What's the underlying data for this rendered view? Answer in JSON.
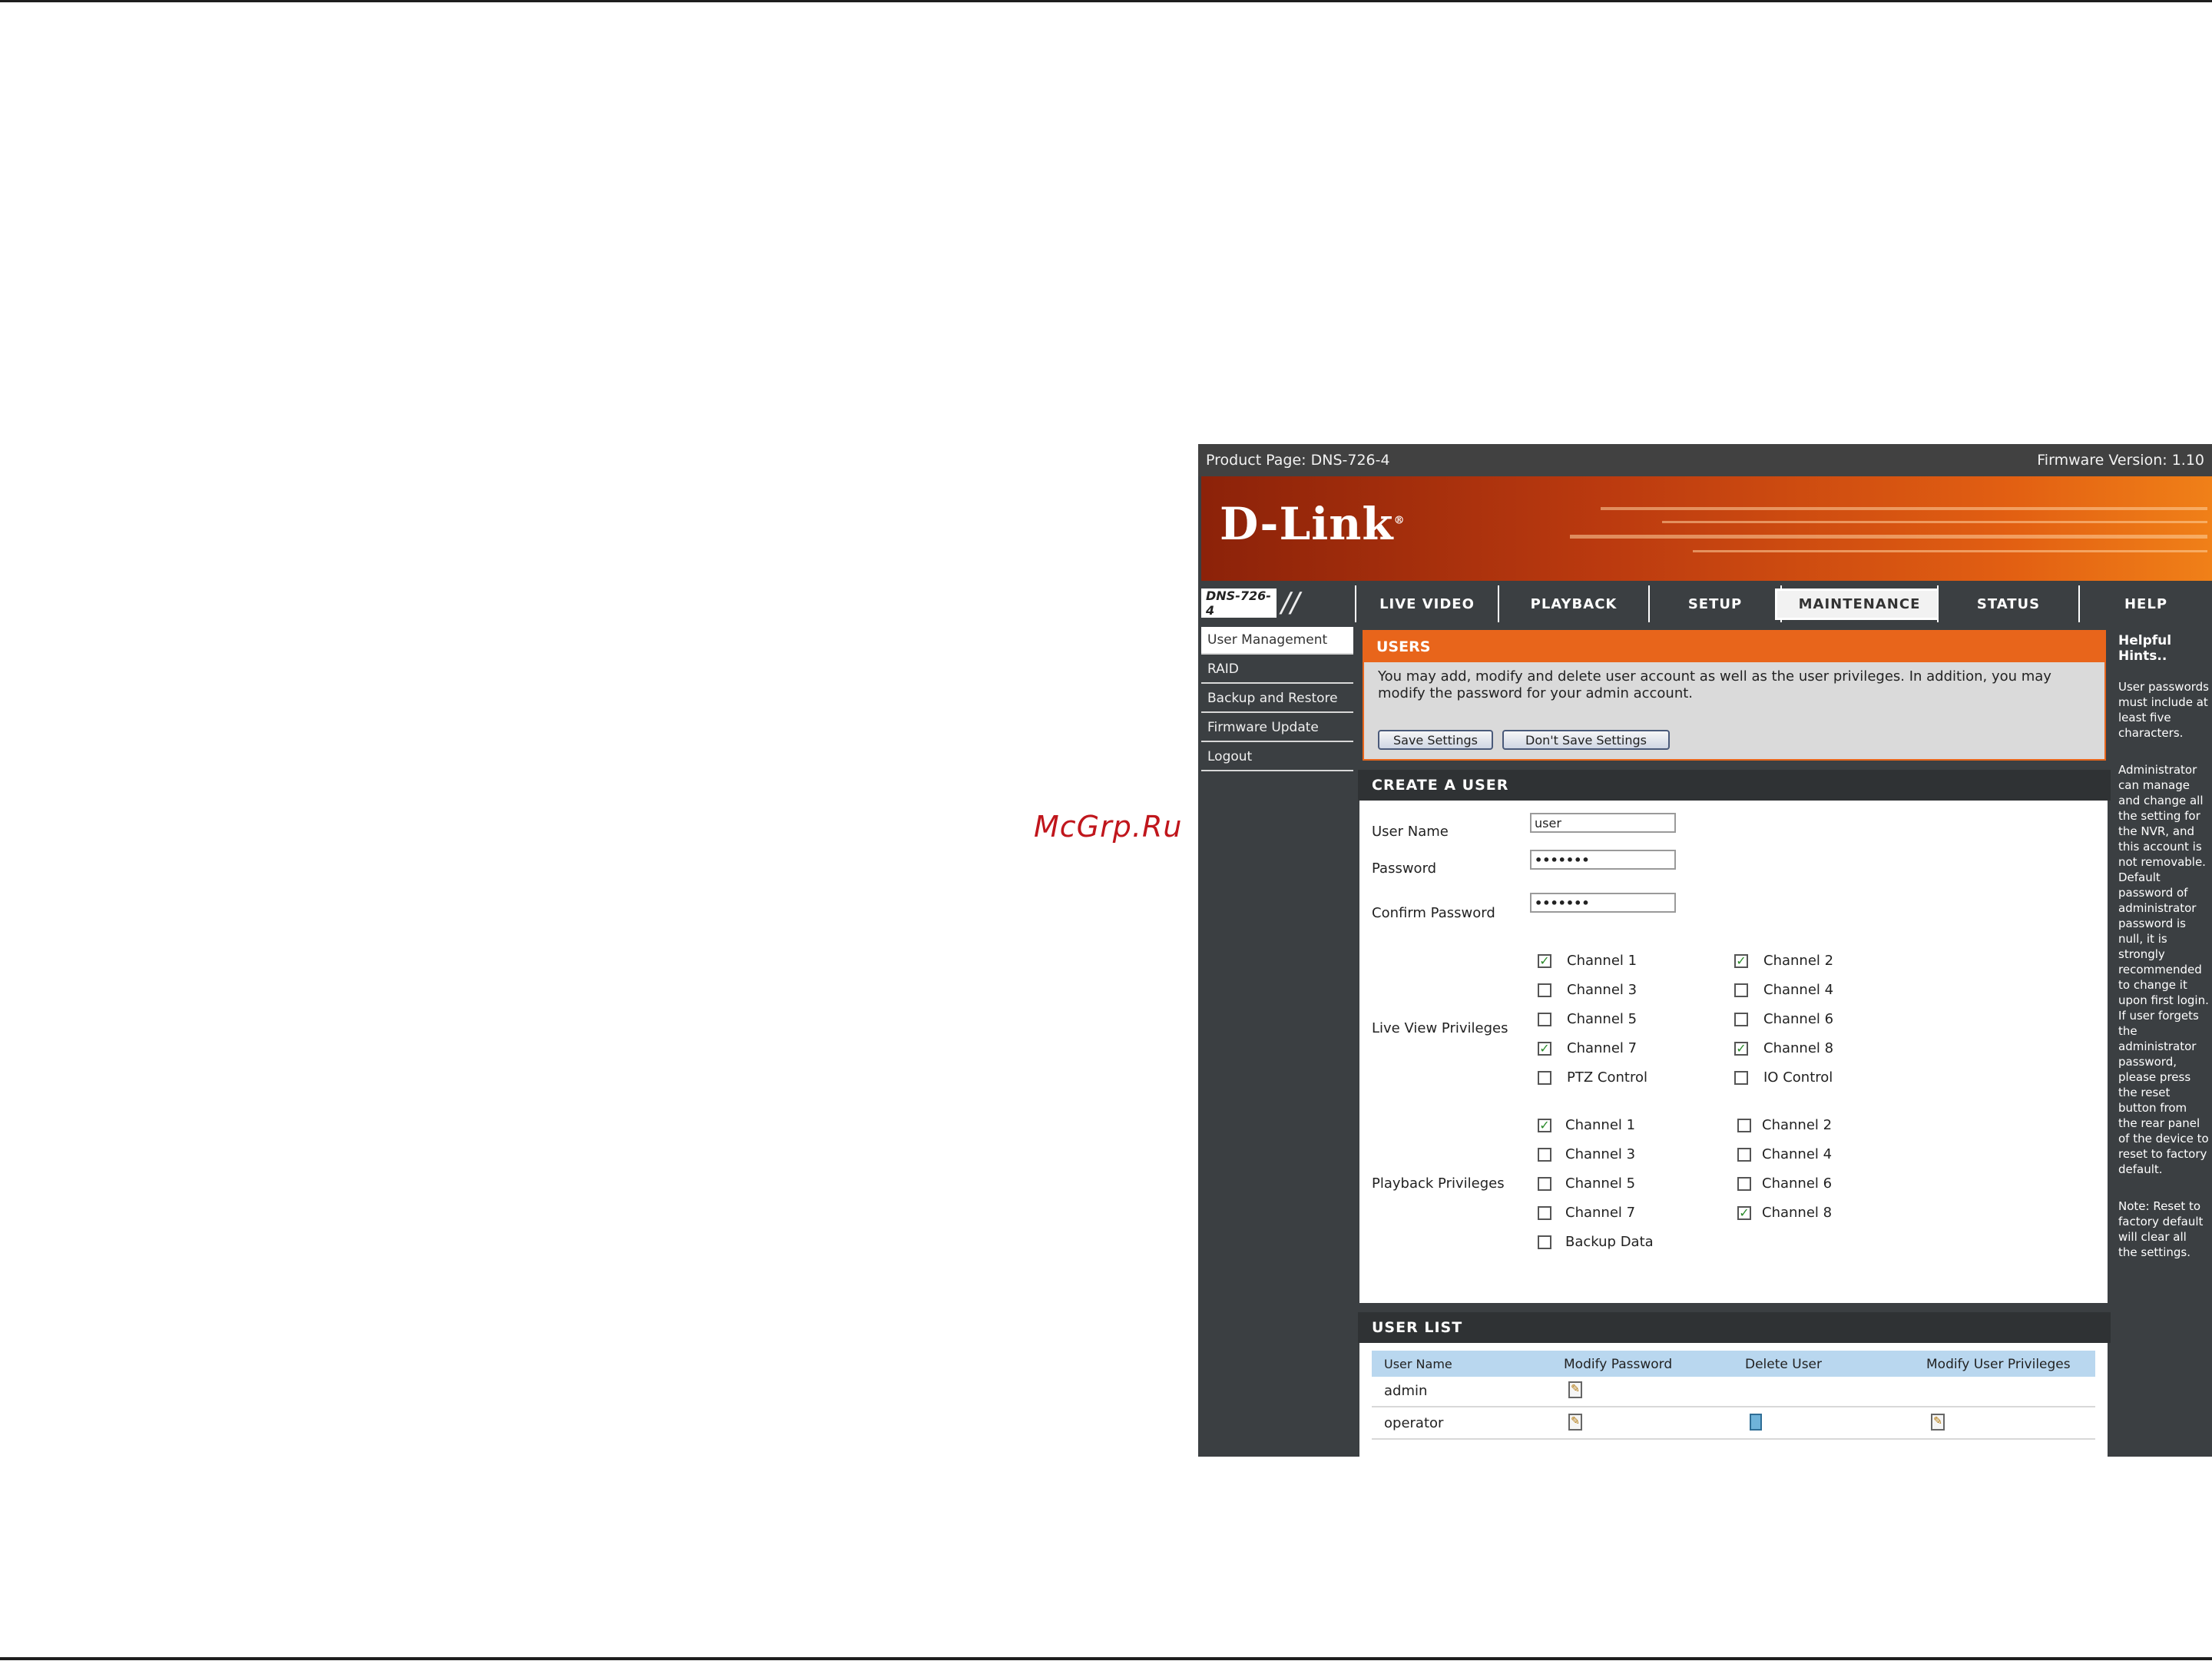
{
  "watermark": "McGrp.Ru",
  "header": {
    "product_page": "Product Page: DNS-726-4",
    "firmware": "Firmware Version: 1.10",
    "logo": "D-Link",
    "model": "DNS-726-4"
  },
  "tabs": [
    {
      "label": "LIVE VIDEO"
    },
    {
      "label": "PLAYBACK"
    },
    {
      "label": "SETUP"
    },
    {
      "label": "MAINTENANCE",
      "active": true
    },
    {
      "label": "STATUS"
    },
    {
      "label": "HELP"
    }
  ],
  "sidebar": {
    "items": [
      {
        "label": "User Management"
      },
      {
        "label": "RAID"
      },
      {
        "label": "Backup and Restore"
      },
      {
        "label": "Firmware Update"
      },
      {
        "label": "Logout"
      }
    ]
  },
  "users": {
    "title": "USERS",
    "description": "You may add, modify and delete user account as well as the user privileges. In addition, you may modify the password for your admin account.",
    "save_label": "Save Settings",
    "dont_save_label": "Don't Save Settings"
  },
  "create_user": {
    "title": "CREATE A USER",
    "user_name_label": "User Name",
    "user_name_value": "user",
    "password_label": "Password",
    "password_value": "•••••••",
    "confirm_label": "Confirm Password",
    "confirm_value": "•••••••",
    "live_view_label": "Live View Privileges",
    "live_view": [
      {
        "label": "Channel 1",
        "checked": true
      },
      {
        "label": "Channel 2",
        "checked": true
      },
      {
        "label": "Channel 3",
        "checked": false
      },
      {
        "label": "Channel 4",
        "checked": false
      },
      {
        "label": "Channel 5",
        "checked": false
      },
      {
        "label": "Channel 6",
        "checked": false
      },
      {
        "label": "Channel 7",
        "checked": true
      },
      {
        "label": "Channel 8",
        "checked": true
      },
      {
        "label": "PTZ Control",
        "checked": false
      },
      {
        "label": "IO Control",
        "checked": false
      }
    ],
    "playback_label": "Playback Privileges",
    "playback": [
      {
        "label": "Channel 1",
        "checked": true
      },
      {
        "label": "Channel 2",
        "checked": false
      },
      {
        "label": "Channel 3",
        "checked": false
      },
      {
        "label": "Channel 4",
        "checked": false
      },
      {
        "label": "Channel 5",
        "checked": false
      },
      {
        "label": "Channel 6",
        "checked": false
      },
      {
        "label": "Channel 7",
        "checked": false
      },
      {
        "label": "Channel 8",
        "checked": true
      },
      {
        "label": "Backup Data",
        "checked": false
      }
    ]
  },
  "user_list": {
    "title": "USER LIST",
    "columns": [
      "User Name",
      "Modify Password",
      "Delete User",
      "Modify User Privileges"
    ],
    "rows": [
      {
        "name": "admin",
        "modify_password": true,
        "delete": false,
        "modify_privileges": false
      },
      {
        "name": "operator",
        "modify_password": true,
        "delete": true,
        "modify_privileges": true
      }
    ]
  },
  "hints": {
    "title": "Helpful Hints..",
    "p1": "User passwords must include at least five characters.",
    "p2": "Administrator can manage and change all the setting for the NVR, and this account is not removable. Default password of administrator password is null, it is strongly recommended to change it upon first login. If user forgets the administrator password, please press the reset button from the rear panel of the device to reset to factory default.",
    "p3": "Note: Reset to factory default will clear all the settings."
  },
  "colors": {
    "accent_orange": "#e8651b",
    "dark_panel": "#3b3f42",
    "table_header_blue": "#b9d7ef",
    "check_green": "#2a8a2a"
  }
}
